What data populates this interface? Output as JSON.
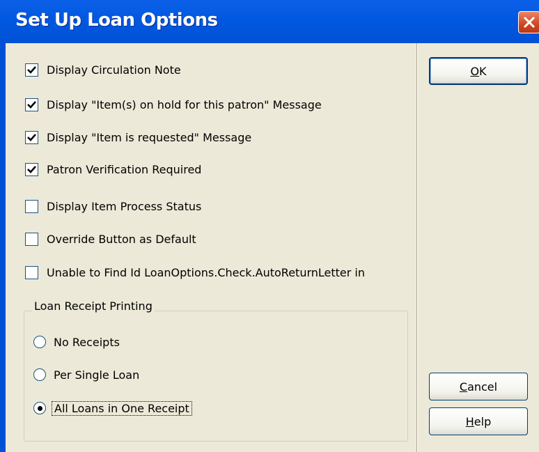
{
  "window": {
    "title": "Set Up Loan Options"
  },
  "options": [
    {
      "label": "Display Circulation Note",
      "checked": true
    },
    {
      "label": "Display \"Item(s) on hold for this patron\" Message",
      "checked": true
    },
    {
      "label": "Display \"Item is requested\" Message",
      "checked": true
    },
    {
      "label": "Patron Verification Required",
      "checked": true
    },
    {
      "label": "Display Item Process Status",
      "checked": false
    },
    {
      "label": "Override Button as Default",
      "checked": false
    },
    {
      "label": "Unable to Find Id LoanOptions.Check.AutoReturnLetter in",
      "checked": false
    }
  ],
  "receipt_group": {
    "label": "Loan Receipt Printing",
    "radios": [
      {
        "label": "No Receipts",
        "selected": false
      },
      {
        "label": "Per Single Loan",
        "selected": false
      },
      {
        "label": "All Loans in One Receipt",
        "selected": true
      }
    ]
  },
  "buttons": {
    "ok": {
      "mnemonic": "O",
      "rest": "K"
    },
    "cancel": {
      "mnemonic": "C",
      "rest": "ancel"
    },
    "help": {
      "mnemonic": "H",
      "rest": "elp"
    }
  },
  "colors": {
    "title_bar": "#0151d6",
    "dialog_bg": "#ece9d8",
    "close_button": "#d0461f"
  }
}
